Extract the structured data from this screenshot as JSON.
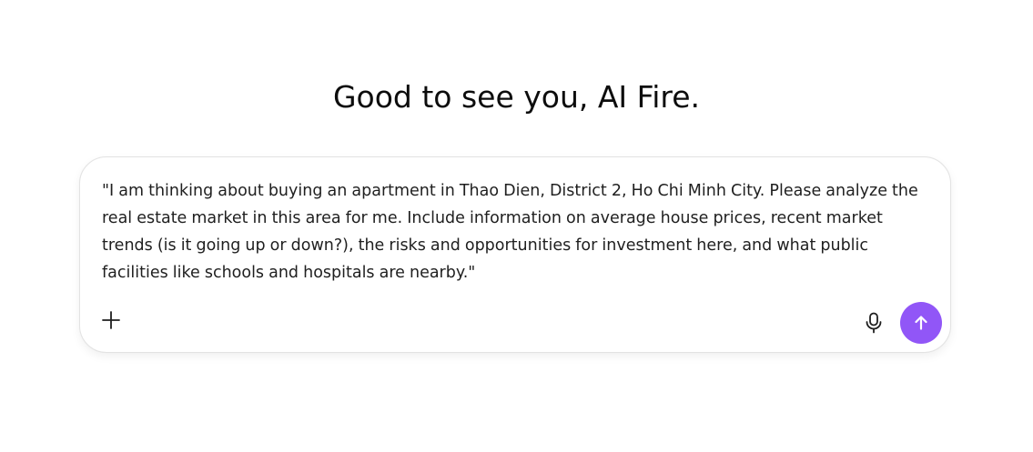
{
  "greeting": "Good to see you, AI Fire.",
  "composer": {
    "prompt_text": "\"I am thinking about buying an apartment in Thao Dien, District 2, Ho Chi Minh City. Please analyze the real estate market in this area for me. Include information on average house prices, recent market trends (is it going up or down?), the risks and opportunities for investment here, and what public facilities like schools and hospitals are nearby.\"",
    "icons": {
      "attach": "plus-icon",
      "voice": "microphone-icon",
      "send": "arrow-up-icon"
    }
  },
  "colors": {
    "send_button": "#9156f7",
    "icon": "#1f1f1f",
    "border": "#e3e3e3"
  }
}
